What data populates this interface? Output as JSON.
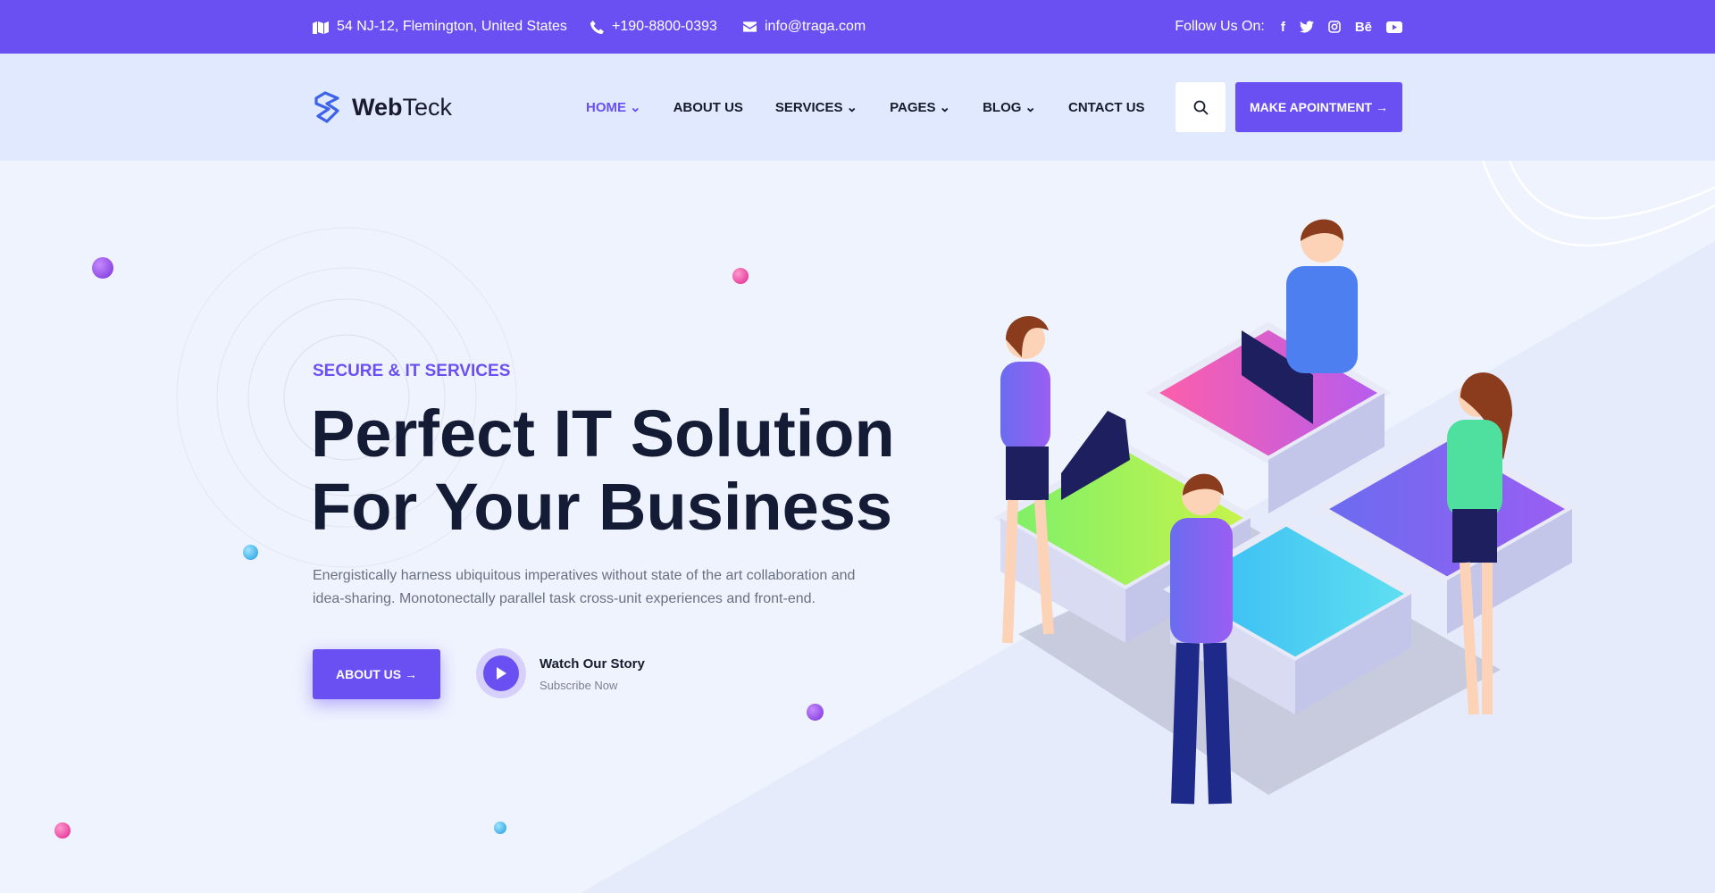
{
  "topbar": {
    "address": "54 NJ-12, Flemington, United States",
    "phone": "+190-8800-0393",
    "email": "info@traga.com",
    "follow_label": "Follow Us On:",
    "social": [
      "facebook-icon",
      "twitter-icon",
      "instagram-icon",
      "behance-icon",
      "youtube-icon"
    ],
    "behance_text": "Bē"
  },
  "header": {
    "logo_bold": "Web",
    "logo_light": "Teck",
    "nav": [
      {
        "label": "HOME",
        "dropdown": true,
        "active": true
      },
      {
        "label": "ABOUT US",
        "dropdown": false
      },
      {
        "label": "SERVICES",
        "dropdown": true
      },
      {
        "label": "PAGES",
        "dropdown": true
      },
      {
        "label": "BLOG",
        "dropdown": true
      },
      {
        "label": "CNTACT US",
        "dropdown": false
      }
    ],
    "cta": "MAKE APOINTMENT →"
  },
  "hero": {
    "subtitle": "SECURE & IT SERVICES",
    "title_line1": "Perfect IT Solution",
    "title_line2": "For Your Business",
    "paragraph": "Energistically harness ubiquitous imperatives without state of the art collaboration and idea-sharing. Monotonectally parallel task cross-unit experiences and front-end.",
    "about_button": "ABOUT US →",
    "watch_title": "Watch Our Story",
    "watch_sub": "Subscribe Now"
  },
  "colors": {
    "brand": "#6a50f3",
    "dark": "#141b34",
    "header_bg": "#e0e9fe"
  }
}
